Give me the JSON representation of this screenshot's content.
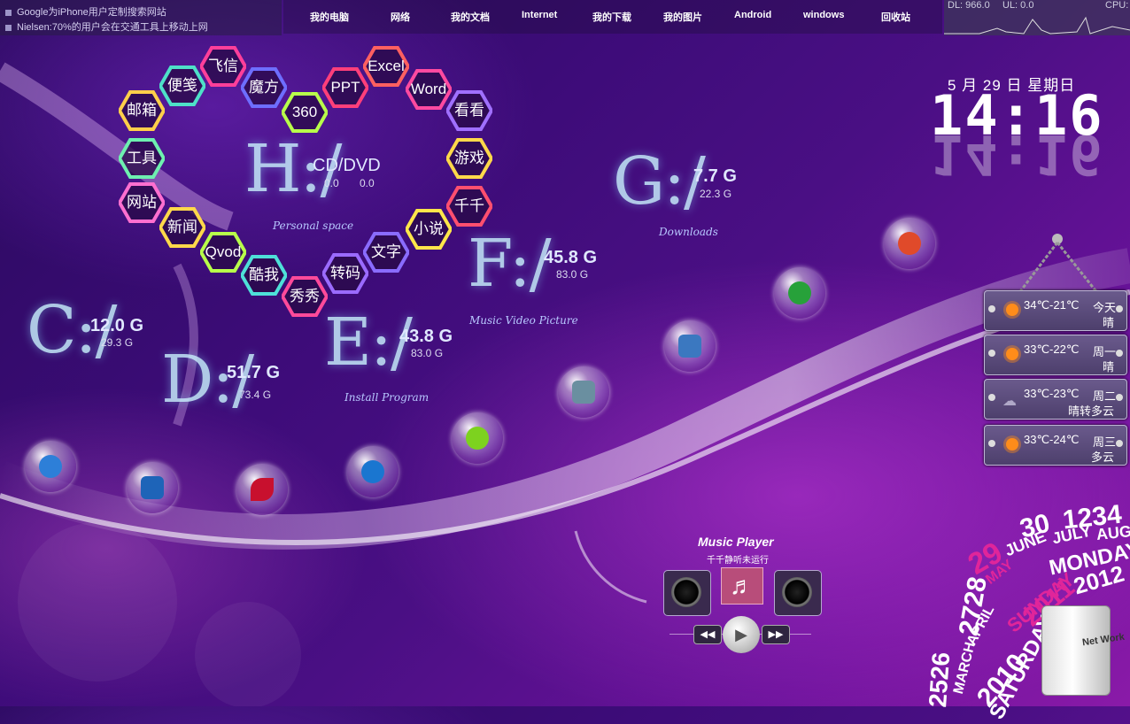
{
  "news": [
    "Google为iPhone用户定制搜索网站",
    "Nielsen:70%的用户会在交通工具上移动上网"
  ],
  "menu": [
    "我的电脑",
    "网络",
    "我的文档",
    "Internet",
    "我的下载",
    "我的图片",
    "Android",
    "windows",
    "回收站"
  ],
  "net": {
    "dl": "DL: 966.0",
    "ul": "UL: 0.0",
    "cpu": "CPU:"
  },
  "hex_items": [
    "飞信",
    "便笺",
    "魔方",
    "邮箱",
    "360",
    "PPT",
    "Excel",
    "Word",
    "看看",
    "游戏",
    "千千",
    "小说",
    "文字",
    "转码",
    "秀秀",
    "酷我",
    "Qvod",
    "新闻",
    "网站",
    "工具"
  ],
  "drives": {
    "h": {
      "letter": "H:/",
      "label": "CD/DVD",
      "used": "0.0",
      "total": "0.0",
      "caption": "Personal space"
    },
    "g": {
      "letter": "G:/",
      "used": "7.7 G",
      "total": "22.3 G",
      "caption": "Downloads"
    },
    "f": {
      "letter": "F:/",
      "used": "45.8 G",
      "total": "83.0 G",
      "caption": "Music Video Picture"
    },
    "e": {
      "letter": "E:/",
      "used": "43.8 G",
      "total": "83.0 G",
      "caption": "Install Program"
    },
    "c": {
      "letter": "C:/",
      "used": "12.0 G",
      "total": "29.3 G"
    },
    "d": {
      "letter": "D:/",
      "used": "51.7 G",
      "total": "73.4 G"
    }
  },
  "clock": {
    "date": "5 月 29 日  星期日",
    "time": "14:16"
  },
  "weather": [
    {
      "temp": "34℃-21℃",
      "day": "今天",
      "cond": "晴",
      "icon": "sun-icon"
    },
    {
      "temp": "33℃-22℃",
      "day": "周一",
      "cond": "晴",
      "icon": "sun-icon"
    },
    {
      "temp": "33℃-23℃",
      "day": "周二",
      "cond": "晴转多云",
      "icon": "cloud-icon"
    },
    {
      "temp": "33℃-24℃",
      "day": "周三",
      "cond": "多云",
      "icon": "sun-icon"
    }
  ],
  "music": {
    "title": "Music Player",
    "status": "千千静听未运行",
    "note": "♬",
    "prev": "◀◀",
    "play": "▶",
    "next": "▶▶"
  },
  "calendar_words": [
    "30",
    "1234",
    "29",
    "JUNE",
    "JULY",
    "AUG",
    "MAY",
    "MONDAY",
    "SUNDAY",
    "2011",
    "2012",
    "2728",
    "APRIL",
    "MARCH",
    "SATURDAY",
    "2010",
    "2526"
  ],
  "fridge_label": "Net Work",
  "colors": {
    "accent": "#b84d7a",
    "bg_dark": "#2a0a5e",
    "bg_light": "#8a1aa8"
  }
}
